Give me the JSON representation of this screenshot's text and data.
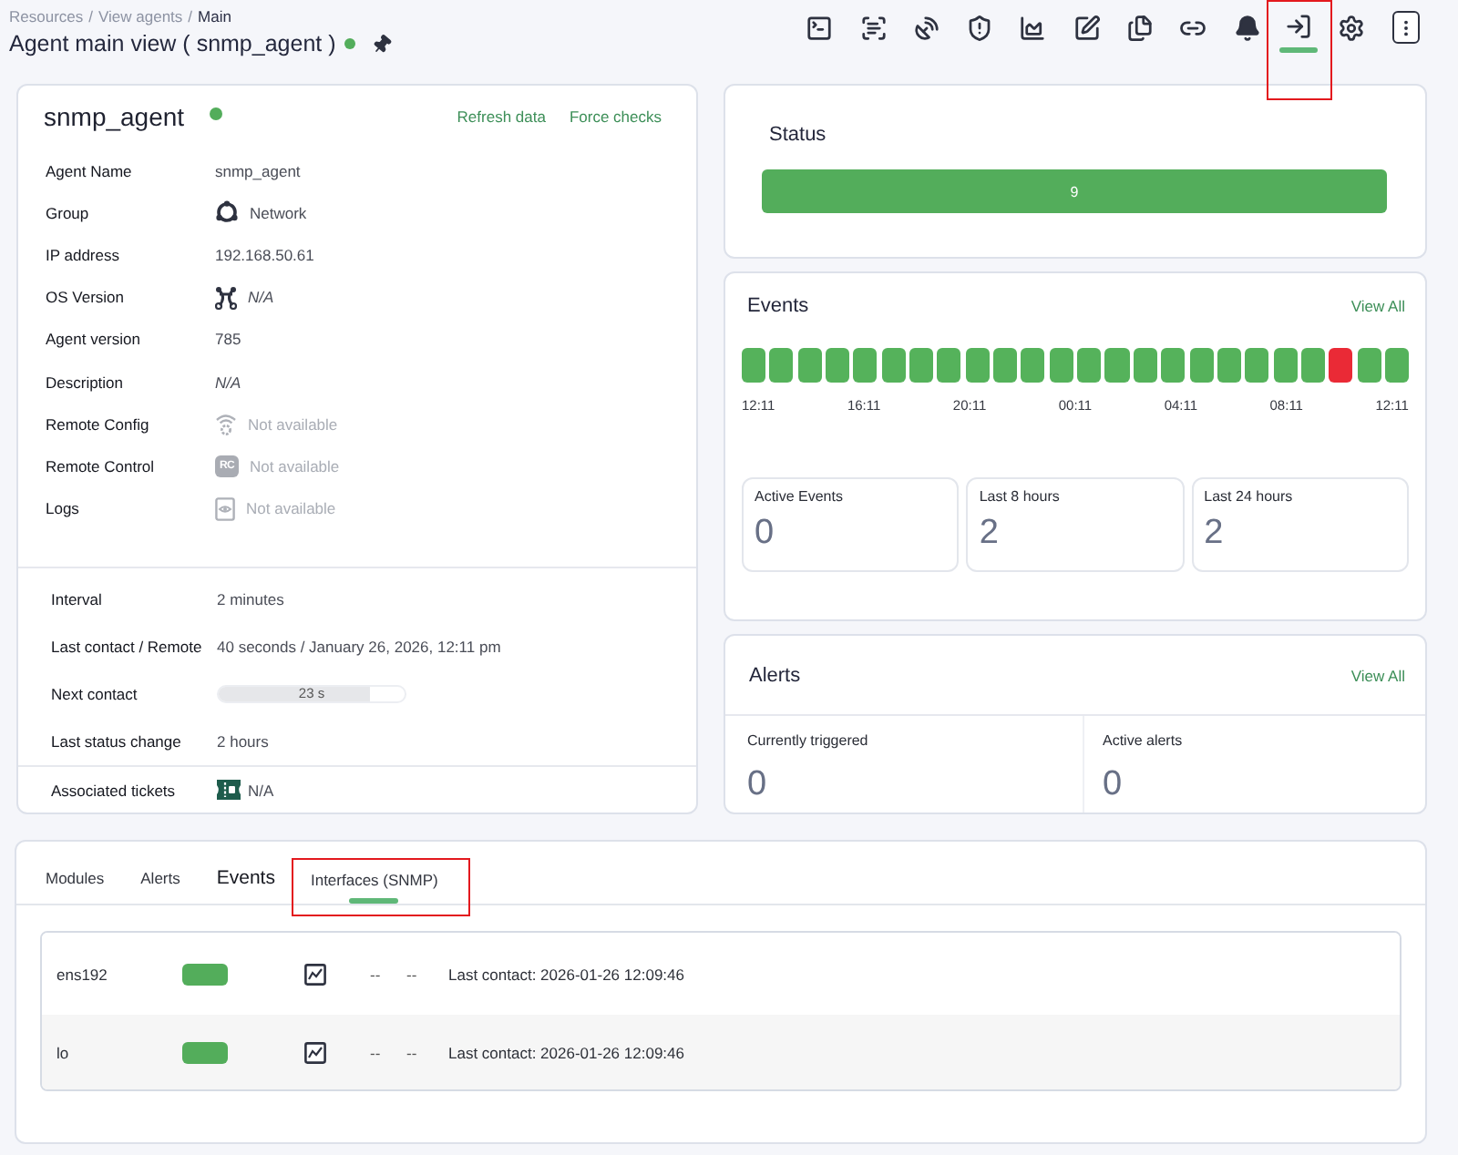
{
  "breadcrumb": {
    "separator": "/",
    "items": [
      {
        "label": "Resources",
        "current": false
      },
      {
        "label": "View agents",
        "current": false
      },
      {
        "label": "Main",
        "current": true
      }
    ]
  },
  "title": {
    "text": "Agent main view ( snmp_agent )",
    "color": "#53ad5b"
  },
  "toolbar": [
    {
      "kind": "terminal",
      "selected": false,
      "highlighted": false
    },
    {
      "kind": "scan",
      "selected": false,
      "highlighted": false
    },
    {
      "kind": "dish",
      "selected": false,
      "highlighted": false
    },
    {
      "kind": "shield",
      "selected": false,
      "highlighted": false
    },
    {
      "kind": "chart",
      "selected": false,
      "highlighted": false
    },
    {
      "kind": "edit",
      "selected": false,
      "highlighted": false
    },
    {
      "kind": "copy",
      "selected": false,
      "highlighted": false
    },
    {
      "kind": "link",
      "selected": false,
      "highlighted": false
    },
    {
      "kind": "bell",
      "selected": false,
      "highlighted": false
    },
    {
      "kind": "login",
      "selected": true,
      "highlighted": true
    },
    {
      "kind": "settings",
      "selected": false,
      "highlighted": false
    },
    {
      "kind": "more",
      "selected": false,
      "highlighted": false
    }
  ],
  "agent": {
    "name": "snmp_agent",
    "color": "#53ad5b",
    "actions": [
      "Refresh data",
      "Force checks"
    ],
    "details": [
      {
        "label": "Agent Name",
        "value": "snmp_agent",
        "kind": "plain"
      },
      {
        "label": "Group",
        "value": "Network",
        "kind": "group"
      },
      {
        "label": "IP address",
        "value": "192.168.50.61",
        "kind": "plain"
      },
      {
        "label": "OS Version",
        "value": "N/A",
        "kind": "os"
      },
      {
        "label": "Agent version",
        "value": "785",
        "kind": "plain"
      },
      {
        "label": "Description",
        "value": "N/A",
        "kind": "italic"
      },
      {
        "label": "Remote Config",
        "value": "Not available",
        "kind": "remote-config"
      },
      {
        "label": "Remote Control",
        "value": "Not available",
        "kind": "remote-control",
        "badge": "RC"
      },
      {
        "label": "Logs",
        "value": "Not available",
        "kind": "logs"
      }
    ],
    "schedule": [
      {
        "label": "Interval",
        "kind": "text",
        "value": "2 minutes"
      },
      {
        "label": "Last contact / Remote",
        "kind": "text",
        "value": "40 seconds / January 26, 2026, 12:11 pm"
      },
      {
        "label": "Next contact",
        "kind": "progress",
        "level": 0.81,
        "reading": "23 s"
      },
      {
        "label": "Last status change",
        "kind": "text",
        "value": "2 hours"
      }
    ],
    "tickets": {
      "label": "Associated tickets",
      "value": "N/A"
    }
  },
  "status_card": {
    "title": "Status",
    "value": "9",
    "color": "#53ad5b"
  },
  "events_card": {
    "title": "Events",
    "link": "View All",
    "timeline": [
      {
        "color": "#55b25b"
      },
      {
        "color": "#55b25b"
      },
      {
        "color": "#55b25b"
      },
      {
        "color": "#55b25b"
      },
      {
        "color": "#55b25b"
      },
      {
        "color": "#55b25b"
      },
      {
        "color": "#55b25b"
      },
      {
        "color": "#55b25b"
      },
      {
        "color": "#55b25b"
      },
      {
        "color": "#55b25b"
      },
      {
        "color": "#55b25b"
      },
      {
        "color": "#55b25b"
      },
      {
        "color": "#55b25b"
      },
      {
        "color": "#55b25b"
      },
      {
        "color": "#55b25b"
      },
      {
        "color": "#55b25b"
      },
      {
        "color": "#55b25b"
      },
      {
        "color": "#55b25b"
      },
      {
        "color": "#55b25b"
      },
      {
        "color": "#55b25b"
      },
      {
        "color": "#55b25b"
      },
      {
        "color": "#ea2a36"
      },
      {
        "color": "#55b25b"
      },
      {
        "color": "#55b25b"
      }
    ],
    "ticks": [
      "12:11",
      "16:11",
      "20:11",
      "00:11",
      "04:11",
      "08:11",
      "12:11"
    ],
    "stats": [
      {
        "label": "Active Events",
        "value": "0"
      },
      {
        "label": "Last 8 hours",
        "value": "2"
      },
      {
        "label": "Last 24 hours",
        "value": "2"
      }
    ]
  },
  "alerts_card": {
    "title": "Alerts",
    "link": "View All",
    "stats": [
      {
        "label": "Currently triggered",
        "value": "0"
      },
      {
        "label": "Active alerts",
        "value": "0"
      }
    ]
  },
  "bottom": {
    "tabs": [
      {
        "label": "Modules",
        "kind": "small",
        "selected": false,
        "highlighted": false
      },
      {
        "label": "Alerts",
        "kind": "small",
        "selected": false,
        "highlighted": false
      },
      {
        "label": "Events",
        "kind": "large",
        "selected": false,
        "highlighted": false
      },
      {
        "label": "Interfaces (SNMP)",
        "kind": "small",
        "selected": true,
        "highlighted": true
      }
    ],
    "interfaces": [
      {
        "name": "ens192",
        "color": "#53ad5b",
        "column_4": "--",
        "column_5": "--",
        "last_contact": "Last contact: 2026-01-26 12:09:46"
      },
      {
        "name": "lo",
        "color": "#53ad5b",
        "column_4": "--",
        "column_5": "--",
        "last_contact": "Last contact: 2026-01-26 12:09:46"
      }
    ]
  }
}
